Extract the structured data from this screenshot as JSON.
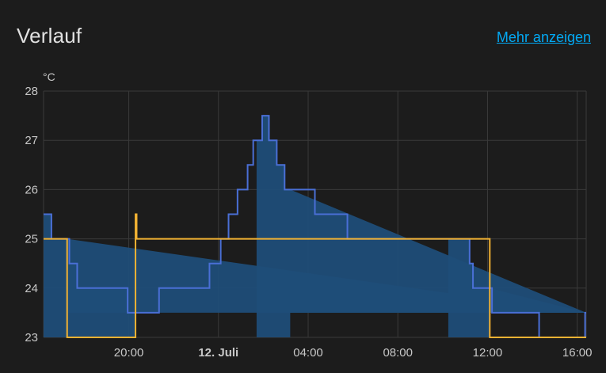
{
  "card": {
    "title": "Verlauf",
    "more_link": "Mehr anzeigen"
  },
  "colors": {
    "background": "#1c1c1c",
    "grid": "#3a3a3a",
    "current_temperature": "#4a6fd6",
    "heating_fill": "#1f4d78",
    "target_temperature": "#f2b233",
    "link": "#03a9f4"
  },
  "chart_data": {
    "type": "line",
    "ylabel": "°C",
    "ylim": [
      23,
      28
    ],
    "yticks": [
      23,
      24,
      25,
      26,
      27,
      28
    ],
    "xlim": [
      16.2,
      40.4
    ],
    "xticks": [
      {
        "h": 20,
        "label": "20:00",
        "bold": false
      },
      {
        "h": 24,
        "label": "12. Juli",
        "bold": true
      },
      {
        "h": 28,
        "label": "04:00",
        "bold": false
      },
      {
        "h": 32,
        "label": "08:00",
        "bold": false
      },
      {
        "h": 36,
        "label": "12:00",
        "bold": false
      },
      {
        "h": 40,
        "label": "16:00",
        "bold": false
      }
    ],
    "x_grid": [
      20,
      24,
      28,
      32,
      36,
      40
    ],
    "series": [
      {
        "key": "current",
        "style": "step",
        "points": [
          [
            16.2,
            25.5
          ],
          [
            16.55,
            25.0
          ],
          [
            17.35,
            24.5
          ],
          [
            17.7,
            24.0
          ],
          [
            19.95,
            23.5
          ],
          [
            21.35,
            24.0
          ],
          [
            23.6,
            24.5
          ],
          [
            24.1,
            25.0
          ],
          [
            24.45,
            25.5
          ],
          [
            24.85,
            26.0
          ],
          [
            25.3,
            26.5
          ],
          [
            25.55,
            27.0
          ],
          [
            25.95,
            27.5
          ],
          [
            26.25,
            27.0
          ],
          [
            26.6,
            26.5
          ],
          [
            26.95,
            26.0
          ],
          [
            28.3,
            25.5
          ],
          [
            29.75,
            25.0
          ],
          [
            35.2,
            24.5
          ],
          [
            35.35,
            24.0
          ],
          [
            36.2,
            23.5
          ],
          [
            38.3,
            23.0
          ],
          [
            40.35,
            23.5
          ],
          [
            40.4,
            23.5
          ]
        ]
      },
      {
        "key": "target",
        "style": "step",
        "points": [
          [
            16.2,
            25.0
          ],
          [
            17.25,
            23.0
          ],
          [
            20.3,
            25.5
          ],
          [
            20.35,
            25.0
          ],
          [
            36.1,
            23.0
          ],
          [
            40.4,
            23.0
          ]
        ]
      }
    ],
    "heating_periods": [
      {
        "start": 16.2,
        "end": 17.25
      },
      {
        "start": 17.25,
        "end": 20.3
      },
      {
        "start": 25.7,
        "end": 27.2
      },
      {
        "start": 34.25,
        "end": 36.1
      }
    ]
  }
}
